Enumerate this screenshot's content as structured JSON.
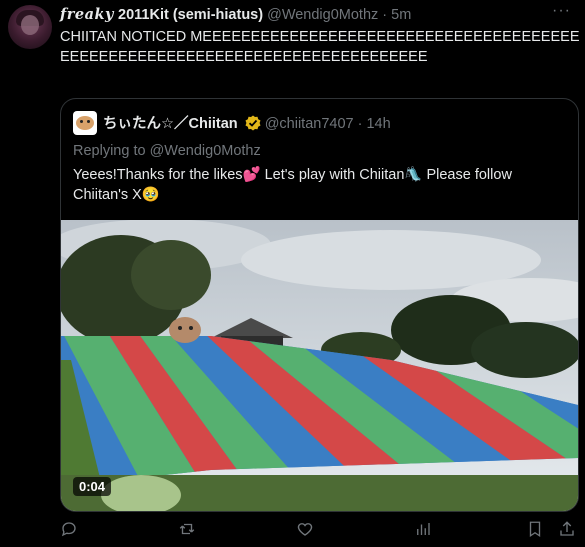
{
  "tweet": {
    "display_name_styled": "𝒇𝒓𝒆𝒂𝒌𝒚",
    "display_name_rest": " 2011Kit (semi-hiatus)",
    "handle": "@Wendig0Mothz",
    "separator": " · ",
    "time": "5m",
    "more_icon": "more-icon",
    "text": "CHIITAN NOTICED MEEEEEEEEEEEEEEEEEEEEEEEEEEEEEEEEEEEEEEEEEEEEEEEEEEEEEEEEEEEEEEEEEEEEEEEEEEEEE"
  },
  "quote": {
    "display_name": "ちぃたん☆／Chiitan",
    "handle": "@chiitan7407",
    "separator": " · ",
    "time": "14h",
    "replying": "Replying to @Wendig0Mothz",
    "text": "Yeees!Thanks for the likes💕  Let's play with Chiitan🛝 Please follow Chiitan's X🥹",
    "video_time": "0:04",
    "verified_color": "#e2b719"
  },
  "actions": {
    "reply_icon": "reply-icon",
    "retweet_icon": "retweet-icon",
    "like_icon": "heart-icon",
    "views_icon": "views-icon",
    "bookmark_icon": "bookmark-icon",
    "share_icon": "share-icon"
  },
  "colors": {
    "background": "#000000",
    "text": "#e7e9ea",
    "muted": "#71767b",
    "border": "#2f3336"
  }
}
